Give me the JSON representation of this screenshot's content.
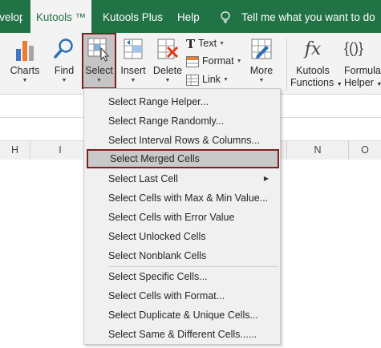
{
  "tabs": [
    {
      "label": "Developer",
      "active": false
    },
    {
      "label": "Kutools ™",
      "active": true
    },
    {
      "label": "Kutools Plus",
      "active": false
    },
    {
      "label": "Help",
      "active": false
    }
  ],
  "tellme": "Tell me what you want to do",
  "ribbon": {
    "charts": "Charts",
    "find": "Find",
    "select": "Select",
    "insert": "Insert",
    "delete": "Delete",
    "text": "Text",
    "format": "Format",
    "link": "Link",
    "more": "More",
    "kutools_functions_1": "Kutools",
    "kutools_functions_2": "Functions",
    "formula_helper_1": "Formula",
    "formula_helper_2": "Helper",
    "fx_glyph": "fx",
    "formula_glyph": "{()}"
  },
  "columns": [
    "H",
    "I",
    "N",
    "O"
  ],
  "menu": {
    "items": [
      {
        "label": "Select Range Helper..."
      },
      {
        "label": "Select Range Randomly..."
      },
      {
        "label": "Select Interval Rows & Columns..."
      },
      {
        "label": "Select Merged Cells"
      },
      {
        "label": "Select Last Cell"
      },
      {
        "label": "Select Cells with Max & Min Value..."
      },
      {
        "label": "Select Cells with Error Value"
      },
      {
        "label": "Select Unlocked Cells"
      },
      {
        "label": "Select Nonblank Cells"
      },
      {
        "label": "Select Specific Cells..."
      },
      {
        "label": "Select Cells with Format..."
      },
      {
        "label": "Select Duplicate & Unique Cells..."
      },
      {
        "label": "Select Same & Different Cells......"
      }
    ],
    "highlighted_index": 3
  },
  "colors": {
    "ribbon_green": "#217346",
    "highlight_border": "#7d1f1f"
  }
}
